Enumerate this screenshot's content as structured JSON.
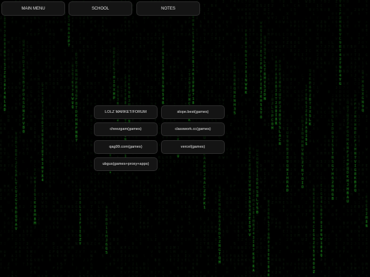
{
  "nav": {
    "main_menu": "MAIN MENU",
    "school": "SCHOOL",
    "notes": "NOTES"
  },
  "links": [
    "LOLZ MARKET/FORUM",
    "slope.best(games)",
    "cheezgam(games)",
    "classwork.cc(games)",
    "qag99.com(games)",
    "vercel(games)",
    "ubgus(games+proxy+apps)"
  ],
  "colors": {
    "background": "#000000",
    "rain_green": "#1f8f1f",
    "button_bg": "#141414",
    "button_text": "#e6e6e6"
  }
}
